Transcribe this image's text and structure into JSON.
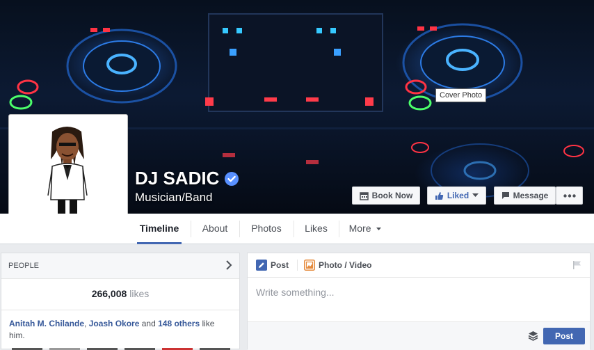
{
  "cover": {
    "tooltip": "Cover Photo"
  },
  "page": {
    "name": "DJ SADIC",
    "category": "Musician/Band"
  },
  "actions": {
    "book_now": "Book Now",
    "liked": "Liked",
    "message": "Message",
    "more_icon": "ellipsis-icon"
  },
  "nav": {
    "tabs": [
      "Timeline",
      "About",
      "Photos",
      "Likes",
      "More"
    ],
    "active": "Timeline"
  },
  "people": {
    "title": "PEOPLE",
    "likes_count": "266,008",
    "likes_label": "likes",
    "friend1": "Anitah M. Chilande",
    "comma": ",",
    "friend2": "Joash Okore",
    "and": " and ",
    "others": "148 others",
    "suffix": " like him."
  },
  "composer": {
    "tab_post": "Post",
    "tab_photo": "Photo / Video",
    "placeholder": "Write something...",
    "post_button": "Post"
  },
  "colors": {
    "brand_blue": "#4267b2",
    "link": "#365899",
    "verified": "#5890ff"
  }
}
